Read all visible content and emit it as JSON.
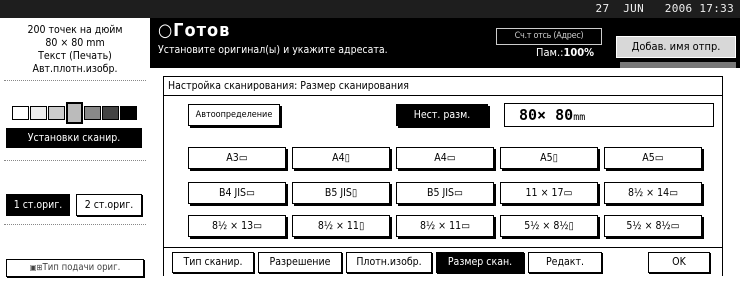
{
  "status_bar": {
    "datetime": "27  JUN   2006 17:33"
  },
  "left_panel": {
    "resolution_line1": "200 точек на дюйм",
    "resolution_line2": "80 × 80 mm",
    "mode": "Текст (Печать)",
    "density": "Авт.плотн.изобр.",
    "density_levels": 7,
    "density_selected_index": 3,
    "scan_settings_button": "Установки сканир.",
    "one_sided_button": "1 ст.ориг.",
    "two_sided_button": "2 ст.ориг.",
    "feed_type_button": "Тип подачи ориг."
  },
  "header": {
    "title": "Готов",
    "subtitle": "Установите оригинал(ы) и укажите адресата.",
    "check_button": "Сч.т отсь (Адрес)",
    "memory_label": "Пам.:",
    "memory_value": "100%",
    "add_name_button": "Добав. имя отпр."
  },
  "dialog": {
    "title": "Настройка сканирования: Размер сканирования",
    "auto_detect_button": "Автоопределение",
    "custom_size_button": "Нест. разм.",
    "custom_size_value": "80× 80",
    "custom_size_unit": "mm",
    "size_rows": [
      [
        "A3▭",
        "A4▯",
        "A4▭",
        "A5▯",
        "A5▭"
      ],
      [
        "B4 JIS▭",
        "B5 JIS▯",
        "B5 JIS▭",
        "11 × 17▭",
        "8½ × 14▭"
      ],
      [
        "8½ × 13▭",
        "8½ × 11▯",
        "8½ × 11▭",
        "5½ × 8½▯",
        "5½ × 8½▭"
      ]
    ],
    "tabs": [
      "Тип сканир.",
      "Разрешение",
      "Плотн.изобр.",
      "Размер скан.",
      "Редакт."
    ],
    "selected_tab": 3,
    "ok_button": "OK"
  },
  "colors": {
    "dark": "#000000",
    "status_bg": "#1e1e1e",
    "panel_gray": "#d8d8d8"
  }
}
